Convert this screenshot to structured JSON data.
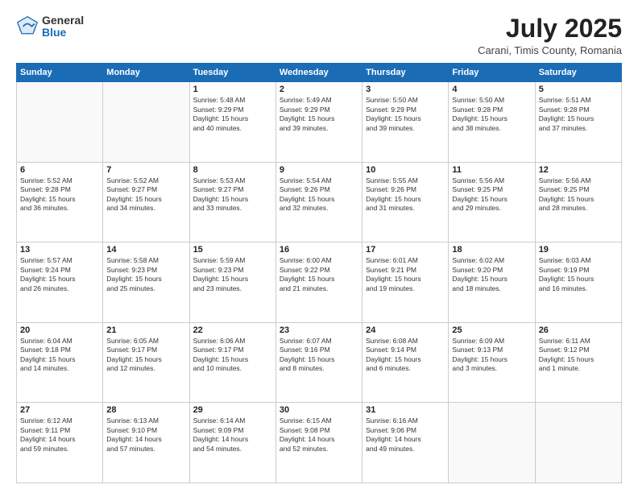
{
  "header": {
    "logo_general": "General",
    "logo_blue": "Blue",
    "title": "July 2025",
    "location": "Carani, Timis County, Romania"
  },
  "weekdays": [
    "Sunday",
    "Monday",
    "Tuesday",
    "Wednesday",
    "Thursday",
    "Friday",
    "Saturday"
  ],
  "weeks": [
    [
      {
        "day": "",
        "info": ""
      },
      {
        "day": "",
        "info": ""
      },
      {
        "day": "1",
        "info": "Sunrise: 5:48 AM\nSunset: 9:29 PM\nDaylight: 15 hours\nand 40 minutes."
      },
      {
        "day": "2",
        "info": "Sunrise: 5:49 AM\nSunset: 9:29 PM\nDaylight: 15 hours\nand 39 minutes."
      },
      {
        "day": "3",
        "info": "Sunrise: 5:50 AM\nSunset: 9:29 PM\nDaylight: 15 hours\nand 39 minutes."
      },
      {
        "day": "4",
        "info": "Sunrise: 5:50 AM\nSunset: 9:28 PM\nDaylight: 15 hours\nand 38 minutes."
      },
      {
        "day": "5",
        "info": "Sunrise: 5:51 AM\nSunset: 9:28 PM\nDaylight: 15 hours\nand 37 minutes."
      }
    ],
    [
      {
        "day": "6",
        "info": "Sunrise: 5:52 AM\nSunset: 9:28 PM\nDaylight: 15 hours\nand 36 minutes."
      },
      {
        "day": "7",
        "info": "Sunrise: 5:52 AM\nSunset: 9:27 PM\nDaylight: 15 hours\nand 34 minutes."
      },
      {
        "day": "8",
        "info": "Sunrise: 5:53 AM\nSunset: 9:27 PM\nDaylight: 15 hours\nand 33 minutes."
      },
      {
        "day": "9",
        "info": "Sunrise: 5:54 AM\nSunset: 9:26 PM\nDaylight: 15 hours\nand 32 minutes."
      },
      {
        "day": "10",
        "info": "Sunrise: 5:55 AM\nSunset: 9:26 PM\nDaylight: 15 hours\nand 31 minutes."
      },
      {
        "day": "11",
        "info": "Sunrise: 5:56 AM\nSunset: 9:25 PM\nDaylight: 15 hours\nand 29 minutes."
      },
      {
        "day": "12",
        "info": "Sunrise: 5:56 AM\nSunset: 9:25 PM\nDaylight: 15 hours\nand 28 minutes."
      }
    ],
    [
      {
        "day": "13",
        "info": "Sunrise: 5:57 AM\nSunset: 9:24 PM\nDaylight: 15 hours\nand 26 minutes."
      },
      {
        "day": "14",
        "info": "Sunrise: 5:58 AM\nSunset: 9:23 PM\nDaylight: 15 hours\nand 25 minutes."
      },
      {
        "day": "15",
        "info": "Sunrise: 5:59 AM\nSunset: 9:23 PM\nDaylight: 15 hours\nand 23 minutes."
      },
      {
        "day": "16",
        "info": "Sunrise: 6:00 AM\nSunset: 9:22 PM\nDaylight: 15 hours\nand 21 minutes."
      },
      {
        "day": "17",
        "info": "Sunrise: 6:01 AM\nSunset: 9:21 PM\nDaylight: 15 hours\nand 19 minutes."
      },
      {
        "day": "18",
        "info": "Sunrise: 6:02 AM\nSunset: 9:20 PM\nDaylight: 15 hours\nand 18 minutes."
      },
      {
        "day": "19",
        "info": "Sunrise: 6:03 AM\nSunset: 9:19 PM\nDaylight: 15 hours\nand 16 minutes."
      }
    ],
    [
      {
        "day": "20",
        "info": "Sunrise: 6:04 AM\nSunset: 9:18 PM\nDaylight: 15 hours\nand 14 minutes."
      },
      {
        "day": "21",
        "info": "Sunrise: 6:05 AM\nSunset: 9:17 PM\nDaylight: 15 hours\nand 12 minutes."
      },
      {
        "day": "22",
        "info": "Sunrise: 6:06 AM\nSunset: 9:17 PM\nDaylight: 15 hours\nand 10 minutes."
      },
      {
        "day": "23",
        "info": "Sunrise: 6:07 AM\nSunset: 9:16 PM\nDaylight: 15 hours\nand 8 minutes."
      },
      {
        "day": "24",
        "info": "Sunrise: 6:08 AM\nSunset: 9:14 PM\nDaylight: 15 hours\nand 6 minutes."
      },
      {
        "day": "25",
        "info": "Sunrise: 6:09 AM\nSunset: 9:13 PM\nDaylight: 15 hours\nand 3 minutes."
      },
      {
        "day": "26",
        "info": "Sunrise: 6:11 AM\nSunset: 9:12 PM\nDaylight: 15 hours\nand 1 minute."
      }
    ],
    [
      {
        "day": "27",
        "info": "Sunrise: 6:12 AM\nSunset: 9:11 PM\nDaylight: 14 hours\nand 59 minutes."
      },
      {
        "day": "28",
        "info": "Sunrise: 6:13 AM\nSunset: 9:10 PM\nDaylight: 14 hours\nand 57 minutes."
      },
      {
        "day": "29",
        "info": "Sunrise: 6:14 AM\nSunset: 9:09 PM\nDaylight: 14 hours\nand 54 minutes."
      },
      {
        "day": "30",
        "info": "Sunrise: 6:15 AM\nSunset: 9:08 PM\nDaylight: 14 hours\nand 52 minutes."
      },
      {
        "day": "31",
        "info": "Sunrise: 6:16 AM\nSunset: 9:06 PM\nDaylight: 14 hours\nand 49 minutes."
      },
      {
        "day": "",
        "info": ""
      },
      {
        "day": "",
        "info": ""
      }
    ]
  ]
}
